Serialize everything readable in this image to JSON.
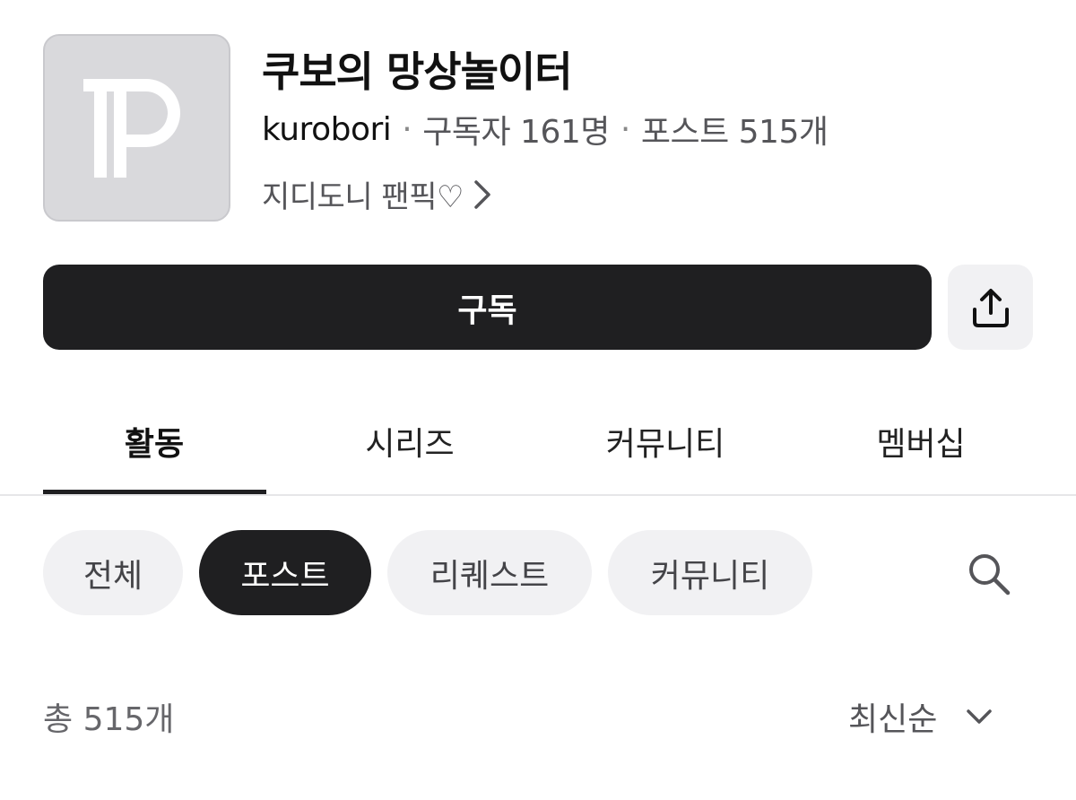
{
  "channel": {
    "title": "쿠보의 망상놀이터",
    "author": "kurobori",
    "separator": "·",
    "subscribers": "구독자 161명",
    "posts": "포스트 515개",
    "description": "지디도니 팬픽♡"
  },
  "actions": {
    "subscribe_label": "구독"
  },
  "tabs": [
    {
      "label": "활동",
      "active": true
    },
    {
      "label": "시리즈",
      "active": false
    },
    {
      "label": "커뮤니티",
      "active": false
    },
    {
      "label": "멤버십",
      "active": false
    }
  ],
  "filters": [
    {
      "label": "전체",
      "active": false
    },
    {
      "label": "포스트",
      "active": true
    },
    {
      "label": "리퀘스트",
      "active": false
    },
    {
      "label": "커뮤니티",
      "active": false
    }
  ],
  "list": {
    "count": "총 515개",
    "sort": "최신순"
  },
  "icons": {
    "logo": "tp-logo-icon",
    "description_link": "chevron-right-icon",
    "share": "share-upload-icon",
    "search": "search-icon",
    "sort": "chevron-down-icon"
  },
  "colors": {
    "primary_dark": "#1f1f21",
    "chip_bg": "#f1f1f3",
    "logo_bg": "#d9d9dc"
  }
}
